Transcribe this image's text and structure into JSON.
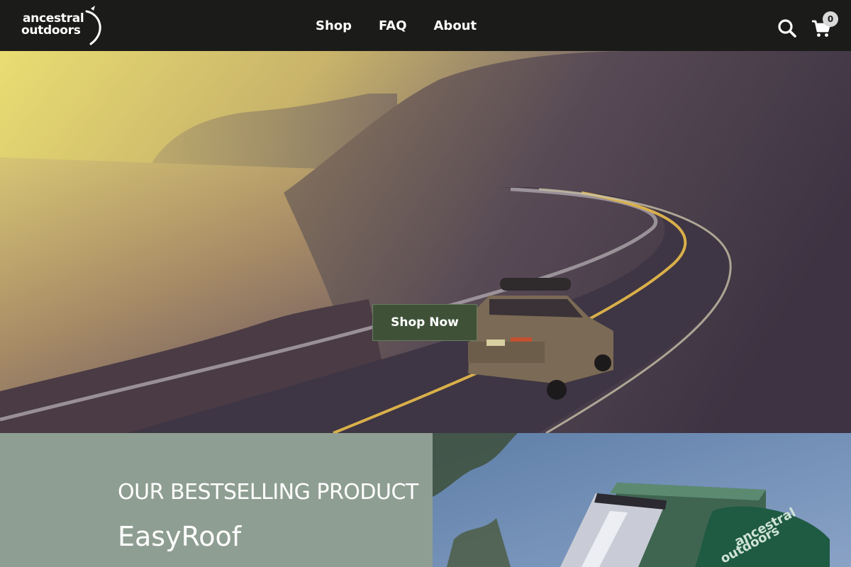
{
  "brand": {
    "logo_line1": "ancestral",
    "logo_line2": "outdoors"
  },
  "nav": {
    "items": [
      {
        "label": "Shop"
      },
      {
        "label": "FAQ"
      },
      {
        "label": "About"
      }
    ]
  },
  "header_icons": {
    "search": "search-icon",
    "cart": "cart-icon",
    "cart_count": "0"
  },
  "hero": {
    "button_label": "Shop Now"
  },
  "product": {
    "kicker": "OUR BESTSELLING PRODUCT",
    "name": "EasyRoof",
    "box_logo_line1": "ancestral",
    "box_logo_line2": "outdoors"
  },
  "colors": {
    "header_bg": "#1b1c19",
    "button_bg": "#3f5238",
    "product_panel_bg": "#8f9e92",
    "pouch_green": "#1f5a43"
  }
}
